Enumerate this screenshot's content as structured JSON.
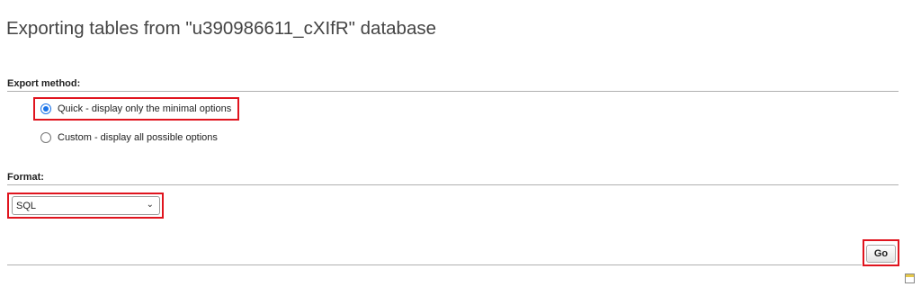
{
  "title": "Exporting tables from \"u390986611_cXIfR\" database",
  "export_method": {
    "label": "Export method:",
    "options": [
      {
        "label": "Quick - display only the minimal options",
        "checked": true
      },
      {
        "label": "Custom - display all possible options",
        "checked": false
      }
    ]
  },
  "format": {
    "label": "Format:",
    "selected": "SQL"
  },
  "go_label": "Go",
  "highlight_color": "#e0141e",
  "radio_accent": "#1a73e8"
}
